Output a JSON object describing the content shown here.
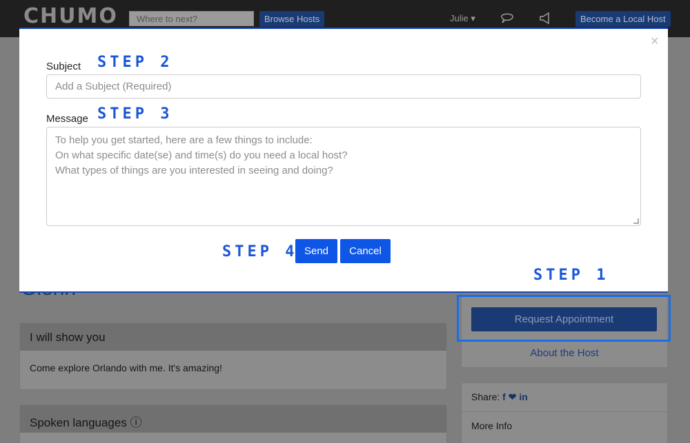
{
  "navbar": {
    "logo": "CHUMO",
    "search_placeholder": "Where to next?",
    "browse_hosts": "Browse Hosts",
    "user": "Julie",
    "become_host": "Become a Local Host"
  },
  "modal": {
    "close": "×",
    "subject_label": "Subject",
    "subject_placeholder": "Add a Subject (Required)",
    "message_label": "Message",
    "message_placeholder": [
      "To help you get started, here are a few things to include:",
      "On what specific date(se) and time(s) do you need a local host?",
      "What types of things are you interested in seeing and doing?"
    ],
    "send": "Send",
    "cancel": "Cancel"
  },
  "steps": {
    "step1": "STEP 1",
    "step2": "STEP 2",
    "step3": "STEP 3",
    "step4": "STEP 4"
  },
  "page": {
    "heading": "Glenn",
    "show_title": "I will show you",
    "show_body": "Come explore Orlando with me. It's amazing!",
    "languages_title": "Spoken languages",
    "request_appointment": "Request Appointment",
    "about_host": "About the Host",
    "share_label": "Share:",
    "share_icons": "f ❤ in",
    "more_info": "More Info"
  },
  "colors": {
    "accent": "#0d56e6",
    "step_text": "#1a56d8",
    "highlight": "#1a6ee8"
  }
}
